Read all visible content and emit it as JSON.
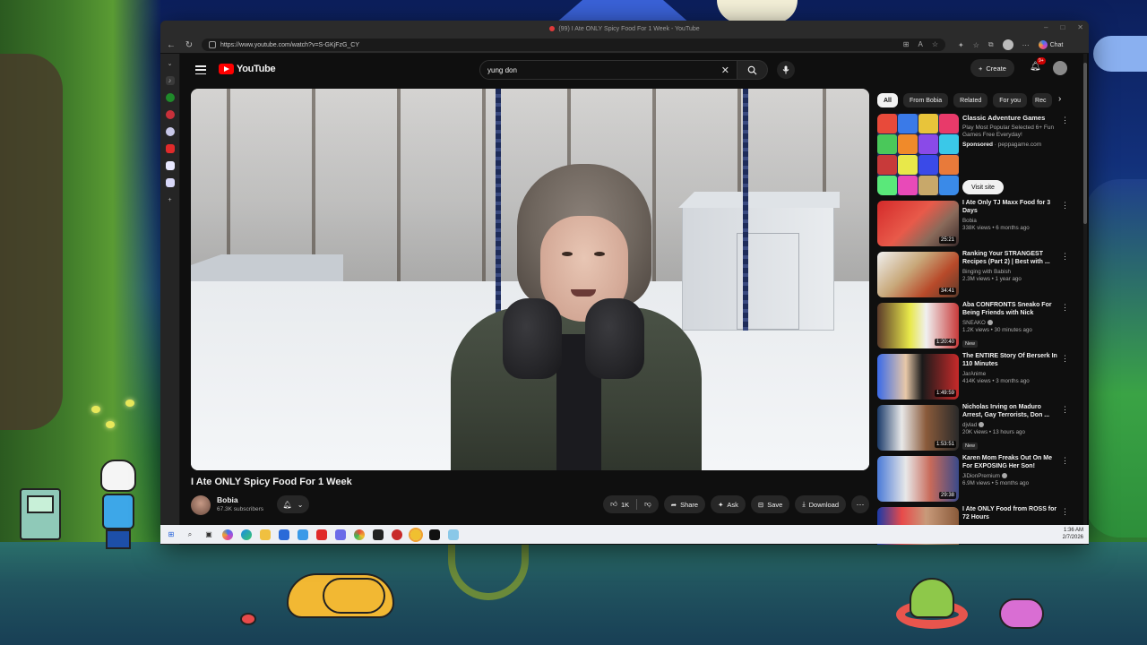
{
  "browser": {
    "tab_title": "(99) I Ate ONLY Spicy Food For 1 Week - YouTube",
    "url": "https://www.youtube.com/watch?v=S-GKjFzG_CY",
    "chat_label": "Chat",
    "win_minimize": "–",
    "win_maximize": "□",
    "win_close": "✕"
  },
  "youtube": {
    "logo_text": "YouTube",
    "search_value": "yung don",
    "create_label": "Create",
    "notification_count": "9+",
    "video": {
      "title": "I Ate ONLY Spicy Food For 1 Week",
      "channel": "Bobia",
      "subscribers": "67.3K subscribers",
      "likes": "1K",
      "share_label": "Share",
      "ask_label": "Ask",
      "save_label": "Save",
      "download_label": "Download"
    },
    "chips": [
      "All",
      "From Bobia",
      "Related",
      "For you",
      "Rec"
    ],
    "ad": {
      "title": "Classic Adventure Games",
      "description": "Play Most Popular Selected 6+ Fun Games Free Everyday!",
      "sponsored_label": "Sponsored",
      "domain": "peppagame.com",
      "visit_label": "Visit site"
    },
    "recommendations": [
      {
        "title": "I Ate Only TJ Maxx Food for 3 Days",
        "channel": "Bobia",
        "meta": "338K views • 6 months ago",
        "duration": "25:21",
        "badge": "",
        "verified": false
      },
      {
        "title": "Ranking Your STRANGEST Recipes (Part 2) | Best with ...",
        "channel": "Binging with Babish",
        "meta": "2.3M views • 1 year ago",
        "duration": "34:41",
        "badge": "",
        "verified": false
      },
      {
        "title": "Aba CONFRONTS Sneako For Being Friends with Nick Fuentes",
        "channel": "SNEAKO",
        "meta": "1.2K views • 30 minutes ago",
        "duration": "1:20:40",
        "badge": "New",
        "verified": true
      },
      {
        "title": "The ENTIRE Story Of Berserk In 110 Minutes",
        "channel": "JarAnime",
        "meta": "414K views • 3 months ago",
        "duration": "1:49:59",
        "badge": "",
        "verified": false
      },
      {
        "title": "Nicholas Irving on Maduro Arrest, Gay Terrorists, Don ...",
        "channel": "djvlad",
        "meta": "20K views • 13 hours ago",
        "duration": "1:53:51",
        "badge": "New",
        "verified": true
      },
      {
        "title": "Karen Mom Freaks Out On Me For EXPOSING Her Son!",
        "channel": "JiDionPremium",
        "meta": "6.9M views • 5 months ago",
        "duration": "29:38",
        "badge": "",
        "verified": true
      },
      {
        "title": "I Ate ONLY Food from ROSS for 72 Hours",
        "channel": "",
        "meta": "",
        "duration": "",
        "badge": "",
        "verified": false
      }
    ]
  },
  "taskbar": {
    "time": "1:36 AM",
    "date": "2/7/2026"
  },
  "colors": {
    "yt_bg": "#0f0f0f",
    "yt_red": "#ff0000",
    "chip_active": "#f1f1f1",
    "text_secondary": "#aaaaaa"
  }
}
